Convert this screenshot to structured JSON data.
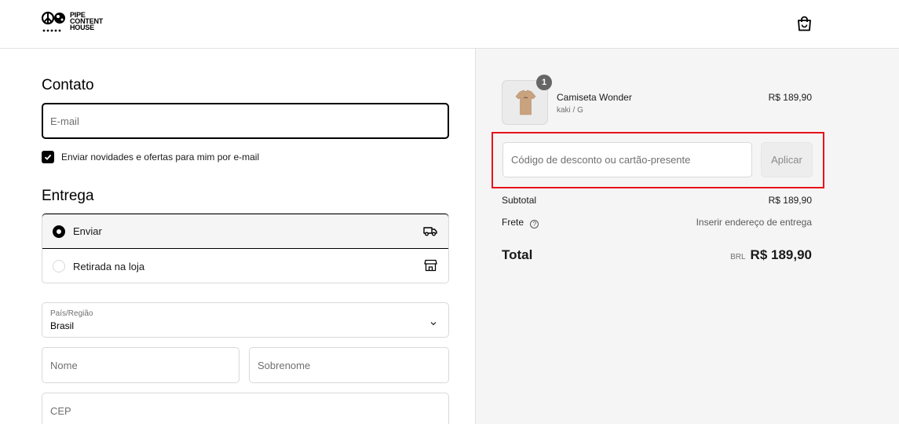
{
  "brand": {
    "logo_text_line1": "PIPE",
    "logo_text_line2": "CONTENT",
    "logo_text_line3": "HOUSE"
  },
  "contact": {
    "heading": "Contato",
    "email_placeholder": "E-mail",
    "newsletter_checked": true,
    "newsletter_label": "Enviar novidades e ofertas para mim por e-mail"
  },
  "delivery": {
    "heading": "Entrega",
    "options": [
      {
        "label": "Enviar",
        "selected": true
      },
      {
        "label": "Retirada na loja",
        "selected": false
      }
    ],
    "country_label": "País/Região",
    "country_value": "Brasil",
    "first_name_placeholder": "Nome",
    "last_name_placeholder": "Sobrenome",
    "cep_placeholder": "CEP"
  },
  "summary": {
    "product": {
      "name": "Camiseta Wonder",
      "variant": "kaki / G",
      "price": "R$ 189,90",
      "quantity": "1"
    },
    "discount_placeholder": "Código de desconto ou cartão-presente",
    "apply_label": "Aplicar",
    "subtotal_label": "Subtotal",
    "subtotal_value": "R$ 189,90",
    "shipping_label": "Frete",
    "shipping_value": "Inserir endereço de entrega",
    "total_label": "Total",
    "currency": "BRL",
    "total_value": "R$ 189,90"
  },
  "colors": {
    "highlight": "#e8121a",
    "summary_bg": "#f5f5f5"
  }
}
